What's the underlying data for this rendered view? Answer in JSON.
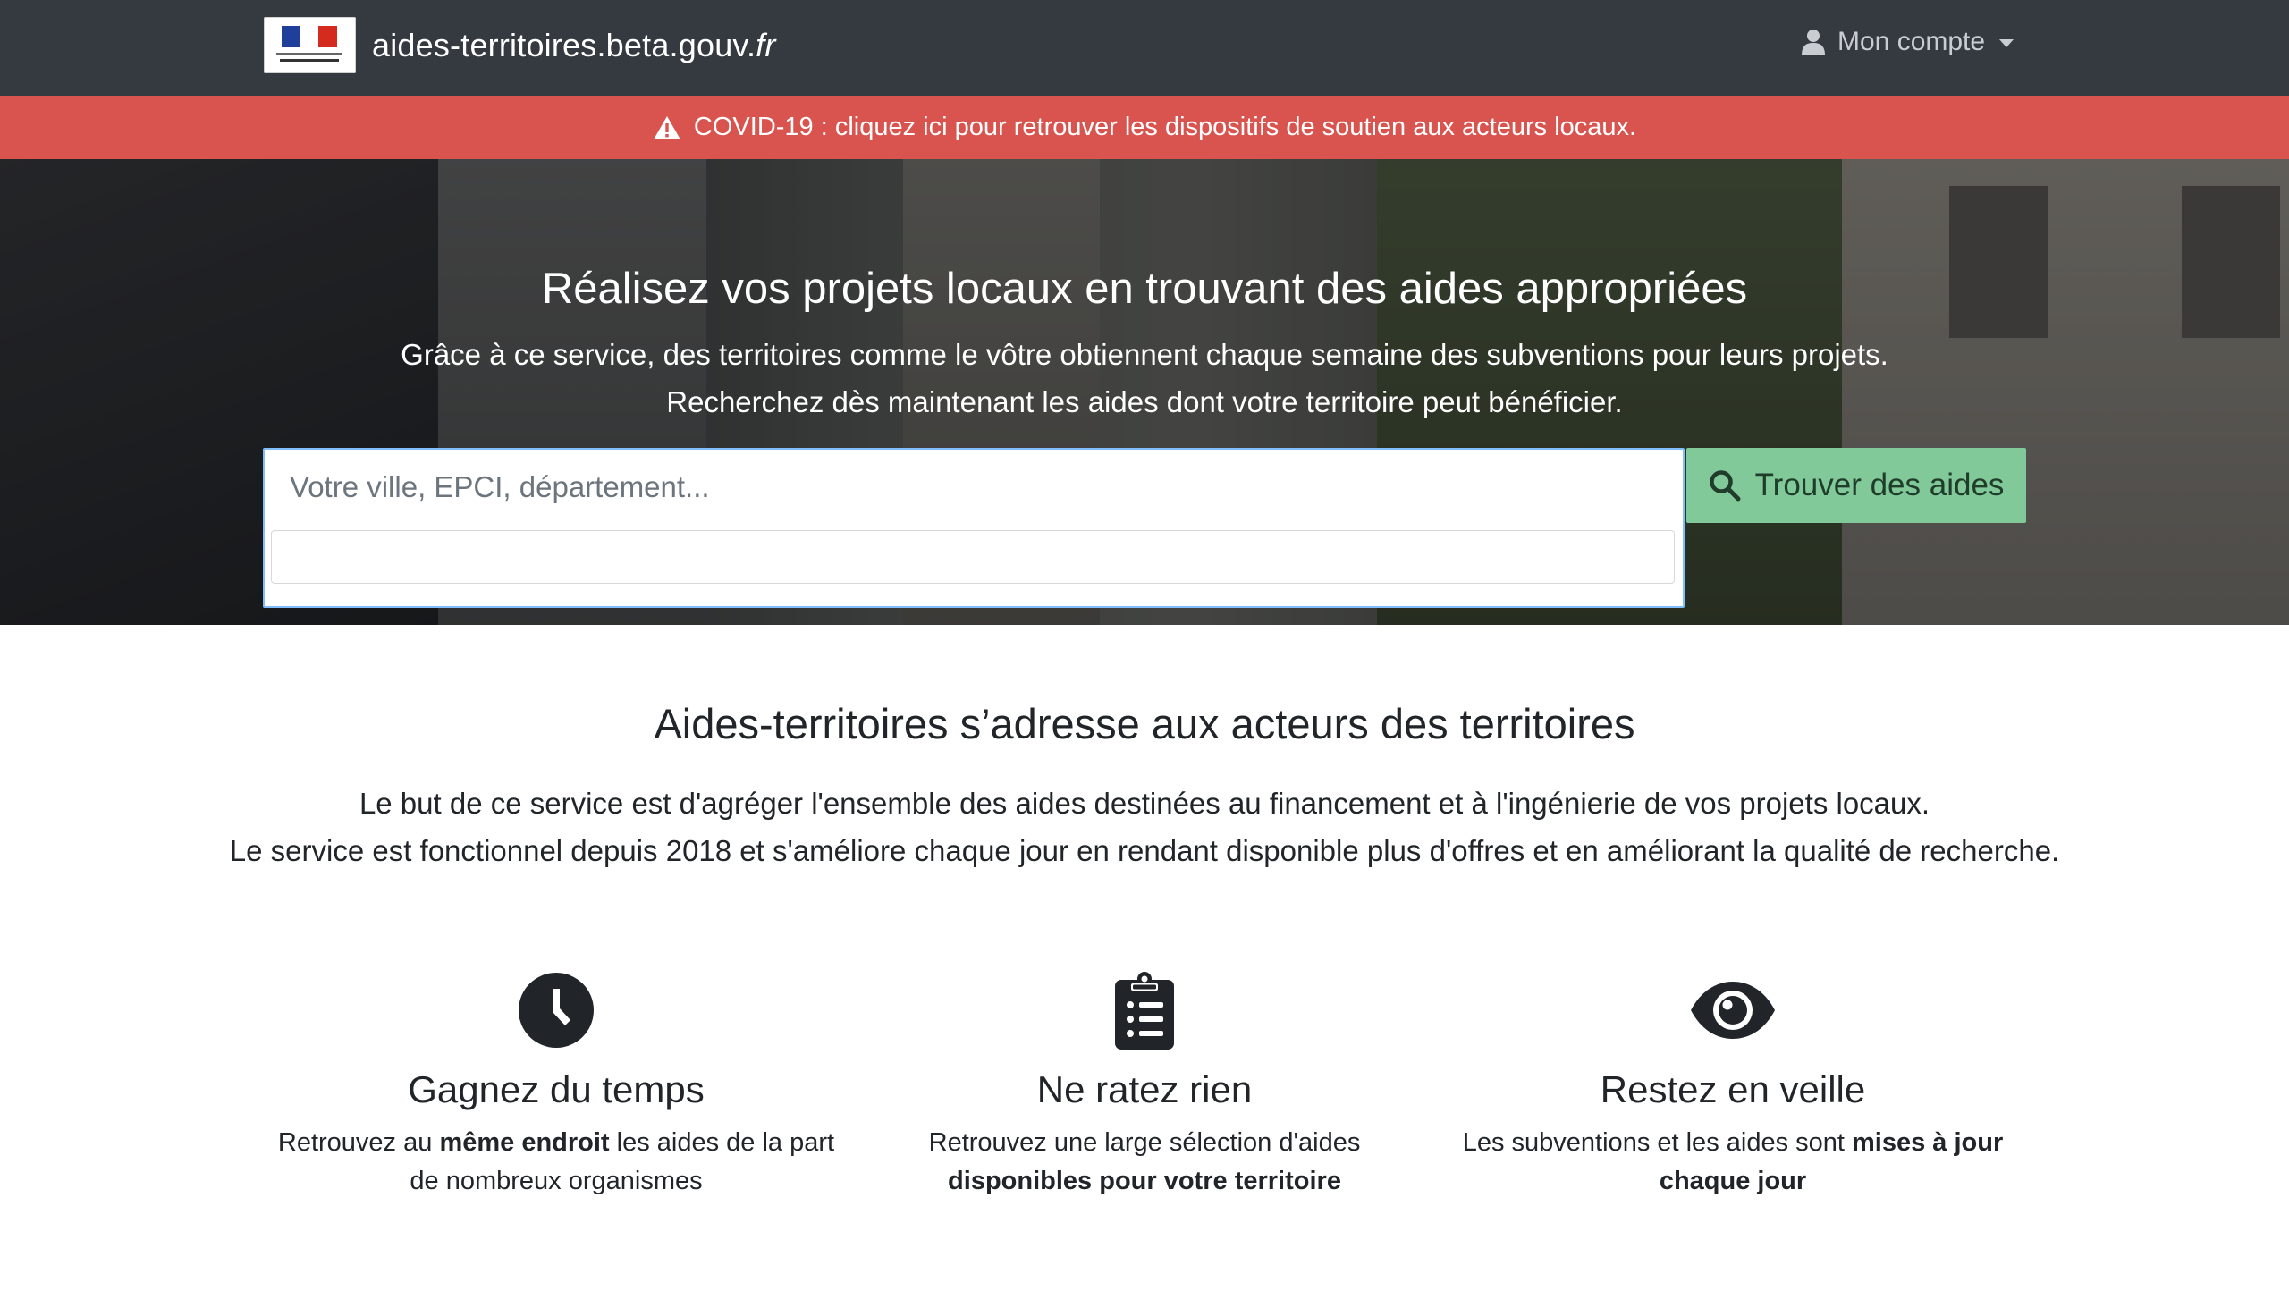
{
  "navbar": {
    "brand_text": "aides-territoires.beta.gouv.",
    "brand_tld": "fr",
    "account_label": "Mon compte"
  },
  "alert": {
    "text": "COVID-19 : cliquez ici pour retrouver les dispositifs de soutien aux acteurs locaux."
  },
  "hero": {
    "title": "Réalisez vos projets locaux en trouvant des aides appropriées",
    "subtitle_line1": "Grâce à ce service, des territoires comme le vôtre obtiennent chaque semaine des subventions pour leurs projets.",
    "subtitle_line2": "Recherchez dès maintenant les aides dont votre territoire peut bénéficier.",
    "search_placeholder": "Votre ville, EPCI, département...",
    "search_button": "Trouver des aides"
  },
  "about": {
    "title": "Aides-territoires s’adresse aux acteurs des territoires",
    "desc_line1": "Le but de ce service est d'agréger l'ensemble des aides destinées au financement et à l'ingénierie de vos projets locaux.",
    "desc_line2": "Le service est fonctionnel depuis 2018 et s'améliore chaque jour en rendant disponible plus d'offres et en améliorant la qualité de recherche."
  },
  "features": [
    {
      "icon": "clock-icon",
      "title": "Gagnez du temps",
      "text_before": "Retrouvez au ",
      "text_bold": "même endroit",
      "text_after": " les aides de la part de nombreux organismes"
    },
    {
      "icon": "clipboard-list-icon",
      "title": "Ne ratez rien",
      "text_before": "Retrouvez une large sélection d'aides ",
      "text_bold": "disponibles pour votre territoire",
      "text_after": ""
    },
    {
      "icon": "eye-icon",
      "title": "Restez en veille",
      "text_before": "Les subventions et les aides sont ",
      "text_bold": "mises à jour chaque jour",
      "text_after": ""
    }
  ],
  "colors": {
    "navbar": "#343a40",
    "alert": "#d9534f",
    "search_button": "#82c99a"
  }
}
